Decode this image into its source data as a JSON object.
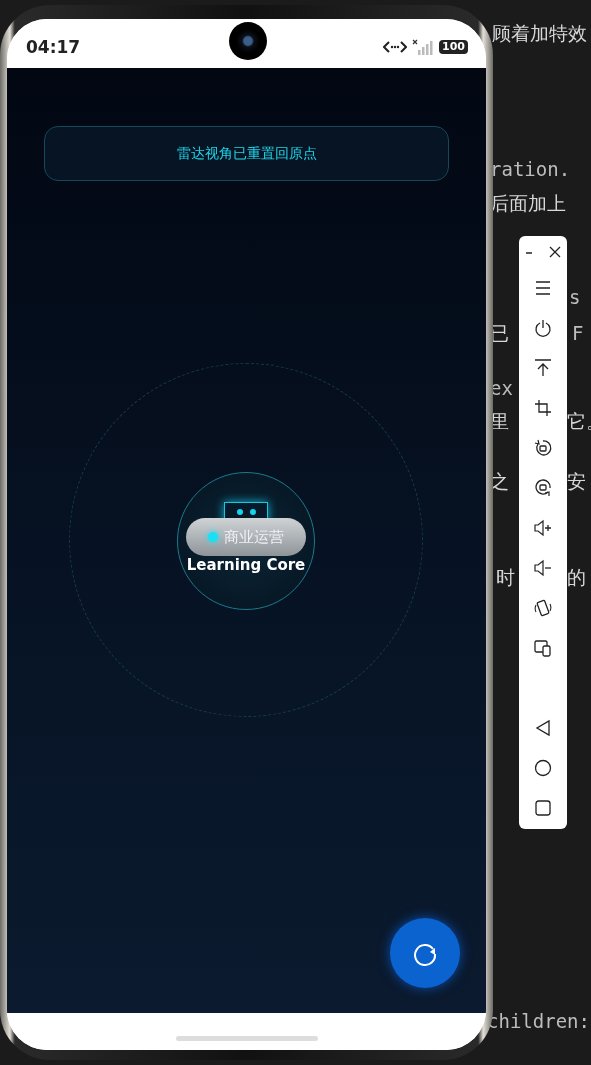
{
  "editor": {
    "fragments": [
      {
        "text": "顾着加特效",
        "kind": "prose"
      },
      {
        "text": "ration.",
        "kind": "code"
      },
      {
        "text": "后面加上",
        "kind": "prose"
      },
      {
        "text": "s",
        "kind": "code"
      },
      {
        "text": "已",
        "kind": "prose"
      },
      {
        "text": "F",
        "kind": "code"
      },
      {
        "text": "ex",
        "kind": "code"
      },
      {
        "text": "里",
        "kind": "prose"
      },
      {
        "text": "它。",
        "kind": "prose"
      },
      {
        "text": "之",
        "kind": "prose"
      },
      {
        "text": "安",
        "kind": "prose"
      },
      {
        "text": "时",
        "kind": "prose"
      },
      {
        "text": "的",
        "kind": "prose"
      },
      {
        "text": "children:",
        "kind": "code"
      }
    ]
  },
  "phone": {
    "status_bar": {
      "time": "04:17",
      "battery": "100"
    },
    "toast": "雷达视角已重置回原点",
    "radar": {
      "node": {
        "tag": "商业运营",
        "title": "Learning Core"
      }
    }
  },
  "toolbar": {
    "window_buttons": [
      {
        "kind": "minimize"
      },
      {
        "kind": "close"
      }
    ],
    "buttons": [
      {
        "kind": "menu"
      },
      {
        "kind": "power"
      },
      {
        "kind": "top"
      },
      {
        "kind": "crop"
      },
      {
        "kind": "rotate-left"
      },
      {
        "kind": "rotate-right"
      },
      {
        "kind": "volume-up"
      },
      {
        "kind": "volume-down"
      },
      {
        "kind": "rotate-phone"
      },
      {
        "kind": "devices"
      }
    ],
    "nav_buttons": [
      {
        "kind": "back"
      },
      {
        "kind": "home"
      },
      {
        "kind": "recent"
      }
    ]
  }
}
